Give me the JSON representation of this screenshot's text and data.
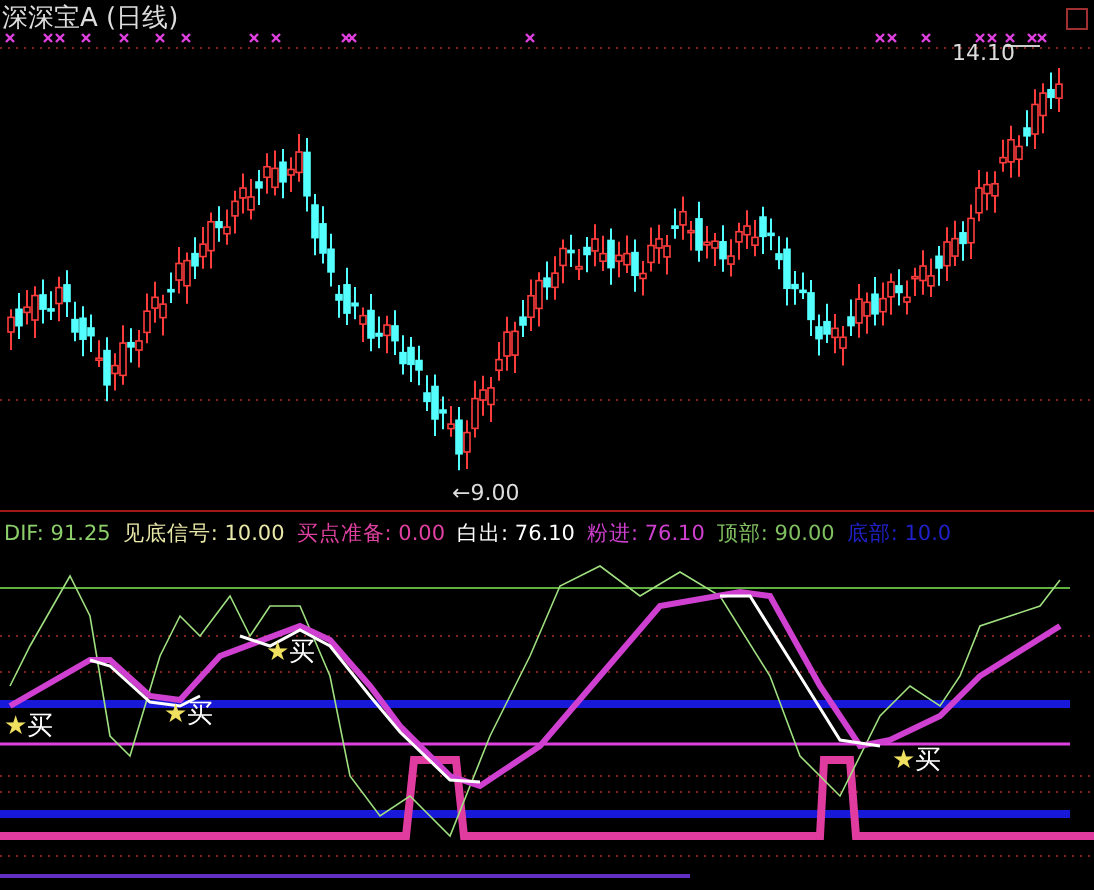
{
  "title": "深深宝A (日线)",
  "price_labels": [
    {
      "text": "14.10",
      "kind": "high"
    },
    {
      "text": "←9.00",
      "kind": "low"
    }
  ],
  "legend": [
    {
      "name": "DIF: ",
      "value": "91.25",
      "color": "#8ccf6a"
    },
    {
      "name": "见底信号: ",
      "value": "10.00",
      "color": "#e8e8a8"
    },
    {
      "name": "买点准备: ",
      "value": "0.00",
      "color": "#e040a0"
    },
    {
      "name": "白出: ",
      "value": "76.10",
      "color": "#ffffff"
    },
    {
      "name": "粉进: ",
      "value": "76.10",
      "color": "#d040d0"
    },
    {
      "name": "顶部: ",
      "value": "90.00",
      "color": "#80c060"
    },
    {
      "name": "底部: ",
      "value": "10.0",
      "color": "#2020c8"
    }
  ],
  "signals": [
    {
      "star": "★",
      "label": "买"
    },
    {
      "star": "★",
      "label": "买"
    },
    {
      "star": "★",
      "label": "买"
    },
    {
      "star": "★",
      "label": "买"
    }
  ]
}
